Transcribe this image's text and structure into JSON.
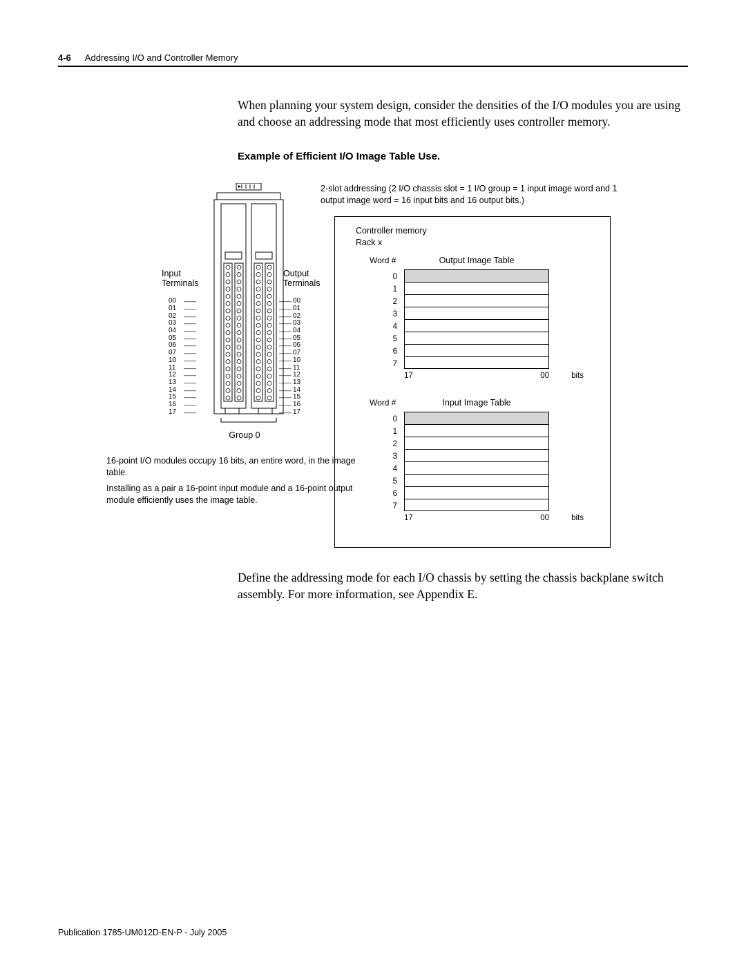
{
  "header": {
    "page_number": "4-6",
    "section": "Addressing I/O and Controller Memory"
  },
  "intro_para": "When planning your system design, consider the densities of the I/O modules you are using and choose an addressing mode that most efficiently uses controller memory.",
  "subheading": "Example of Efficient I/O Image Table Use.",
  "addressing_note": "2-slot addressing  (2 I/O chassis slot = 1 I/O group = 1 input image word and 1 output image word = 16 input bits and 16 output bits.)",
  "rack": {
    "input_label": "Input Terminals",
    "output_label": "Output Terminals",
    "terminal_numbers": [
      "00",
      "01",
      "02",
      "03",
      "04",
      "05",
      "06",
      "07",
      "10",
      "11",
      "12",
      "13",
      "14",
      "15",
      "16",
      "17"
    ],
    "group_label": "Group 0"
  },
  "module_note_1": "16-point I/O modules occupy 16 bits, an entire word, in the image table.",
  "module_note_2": "Installing as a pair a 16-point input module and a 16-point output module efficiently uses the image table.",
  "memory": {
    "title_line1": "Controller memory",
    "title_line2": "Rack x",
    "word_header": "Word #",
    "output_title": "Output Image Table",
    "input_title": "Input Image Table",
    "word_numbers": [
      "0",
      "1",
      "2",
      "3",
      "4",
      "5",
      "6",
      "7"
    ],
    "bit_high": "17",
    "bit_low": "00",
    "bit_label": "bits"
  },
  "closing_para": "Define the addressing mode for each I/O chassis by setting the chassis backplane switch assembly. For more information, see Appendix E.",
  "footer": "Publication 1785-UM012D-EN-P - July 2005",
  "chart_data": {
    "type": "table",
    "description": "Two 8-word image tables (Output and Input), each word spans bits 17..00. Word 0 is shaded (used by Group 0 16-point module pair), words 1-7 unused.",
    "tables": [
      {
        "name": "Output Image Table",
        "words": [
          0,
          1,
          2,
          3,
          4,
          5,
          6,
          7
        ],
        "bit_range": [
          17,
          0
        ],
        "used_words": [
          0
        ]
      },
      {
        "name": "Input Image Table",
        "words": [
          0,
          1,
          2,
          3,
          4,
          5,
          6,
          7
        ],
        "bit_range": [
          17,
          0
        ],
        "used_words": [
          0
        ]
      }
    ]
  }
}
